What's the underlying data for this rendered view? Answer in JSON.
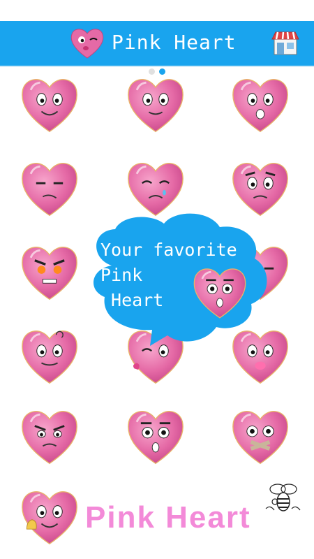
{
  "header": {
    "title": "Pink Heart",
    "logo": "kissing-heart-icon",
    "store_icon": "store-icon",
    "bar_color": "#19a4ee"
  },
  "pager": {
    "page_count": 2,
    "active_index": 1
  },
  "stickers": [
    {
      "name": "happy-heart"
    },
    {
      "name": "blushing-heart"
    },
    {
      "name": "shocked-heart"
    },
    {
      "name": "bored-heart"
    },
    {
      "name": "crying-heart"
    },
    {
      "name": "worried-heart"
    },
    {
      "name": "angry-heart"
    },
    {
      "name": "partially-hidden-heart"
    },
    {
      "name": "sly-heart"
    },
    {
      "name": "dizzy-heart"
    },
    {
      "name": "kissing-heart"
    },
    {
      "name": "kiss-lips-heart"
    },
    {
      "name": "grumpy-heart"
    },
    {
      "name": "surprised-heart"
    },
    {
      "name": "taped-mouth-heart"
    },
    {
      "name": "waving-heart"
    }
  ],
  "bubble": {
    "text": "Your favorite\nPink\n Heart",
    "color": "#19a4ee"
  },
  "footer": {
    "title": "Pink Heart",
    "color": "#f38ad8",
    "mascot": "bee-icon"
  }
}
